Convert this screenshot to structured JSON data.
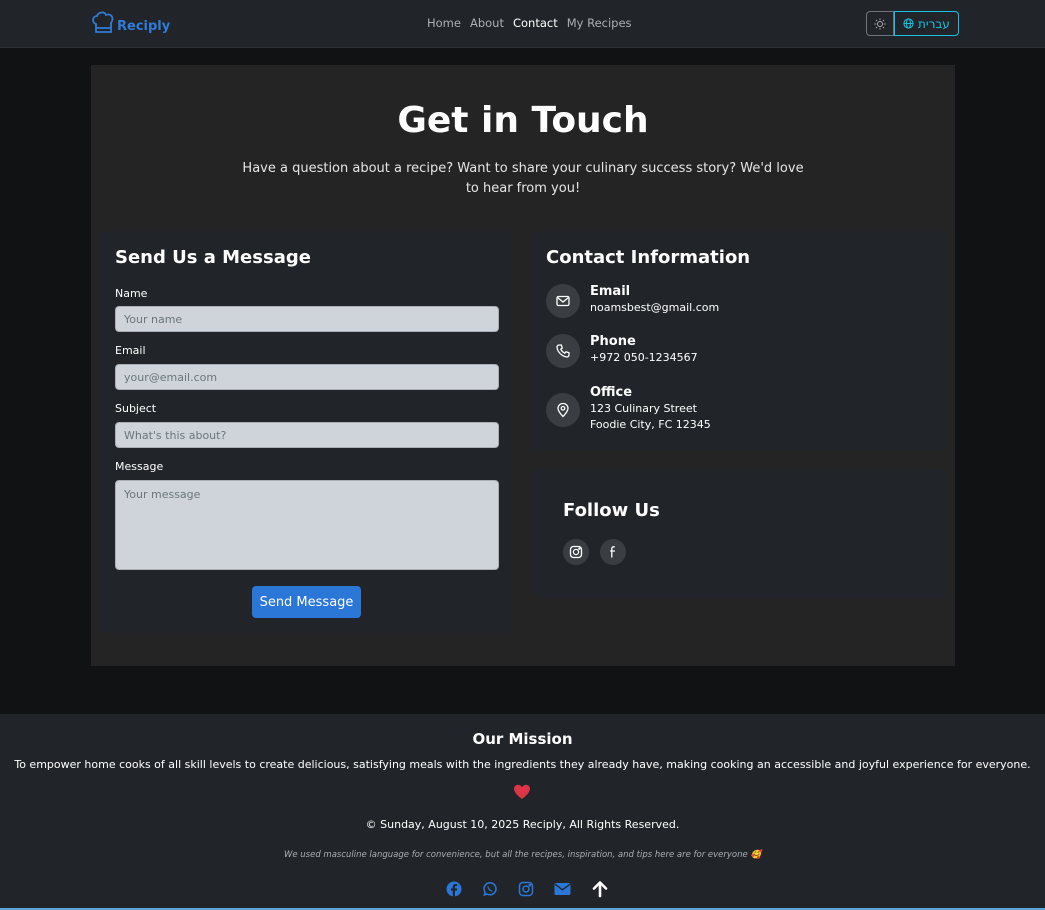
{
  "nav": {
    "brand": "Reciply",
    "links": [
      "Home",
      "About",
      "Contact",
      "My Recipes"
    ],
    "active": "Contact",
    "lang_label": "עברית"
  },
  "hero": {
    "title": "Get in Touch",
    "subtitle": "Have a question about a recipe? Want to share your culinary success story? We'd love to hear from you!"
  },
  "form": {
    "title": "Send Us a Message",
    "name_label": "Name",
    "name_placeholder": "Your name",
    "email_label": "Email",
    "email_placeholder": "your@email.com",
    "subject_label": "Subject",
    "subject_placeholder": "What's this about?",
    "message_label": "Message",
    "message_placeholder": "Your message",
    "submit_label": "Send Message"
  },
  "contact": {
    "title": "Contact Information",
    "email_title": "Email",
    "email_value": "noamsbest@gmail.com",
    "phone_title": "Phone",
    "phone_value": "+972 050-1234567",
    "office_title": "Office",
    "office_line1": "123 Culinary Street",
    "office_line2": "Foodie City, FC 12345"
  },
  "follow": {
    "title": "Follow Us",
    "icons": [
      "instagram-icon",
      "facebook-icon"
    ]
  },
  "footer": {
    "mission_title": "Our Mission",
    "mission_text": "To empower home cooks of all skill levels to create delicious, satisfying meals with the ingredients they already have, making cooking an accessible and joyful experience for everyone.",
    "copyright": "© Sunday, August 10, 2025 Reciply, All Rights Reserved.",
    "note": "We used masculine language for convenience, but all the recipes, inspiration, and tips here are for everyone 🥰",
    "icons": [
      "facebook-icon",
      "whatsapp-icon",
      "instagram-icon",
      "mail-icon",
      "arrow-up-icon"
    ]
  },
  "colors": {
    "accent": "#2b77d8",
    "lang_accent": "#17c1e3",
    "heart": "#dc3545"
  }
}
